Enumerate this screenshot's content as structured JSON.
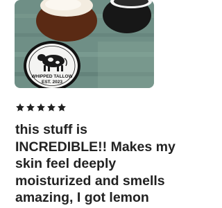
{
  "review": {
    "photo": {
      "jar_label_line1": "WHIPPED TALLOW",
      "jar_label_line2": "EST. 2023"
    },
    "rating": {
      "stars": 5,
      "max": 5,
      "star_color": "#222222"
    },
    "text": "this stuff is\nINCREDIBLE!! Makes my\nskin feel deeply\nmoisturized and smells\namazing, I got lemon"
  }
}
